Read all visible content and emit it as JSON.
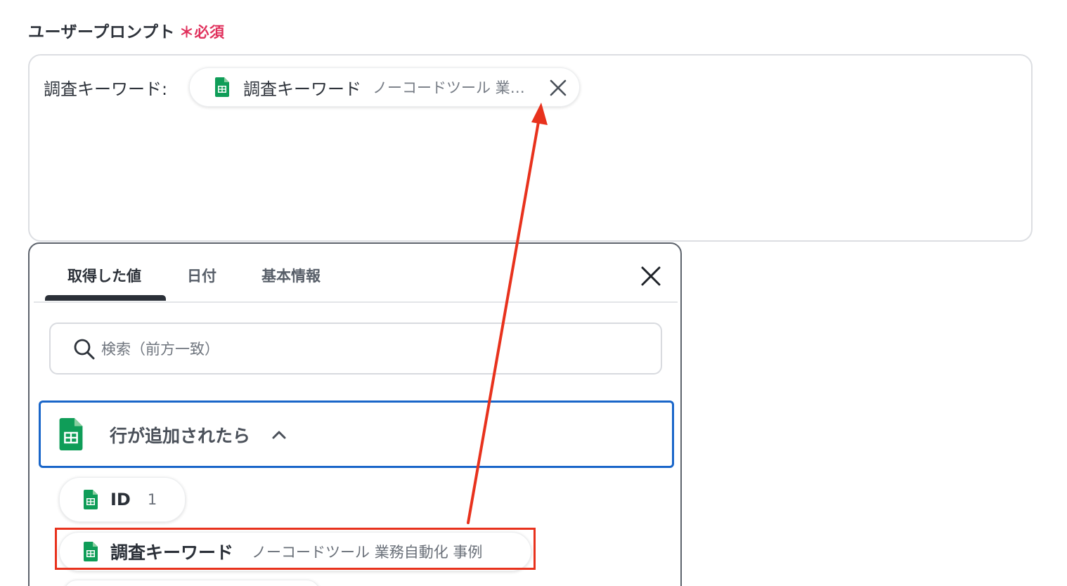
{
  "field": {
    "label": "ユーザープロンプト",
    "required_mark": "＊必須"
  },
  "prompt": {
    "prefix": "調査キーワード:",
    "chip": {
      "icon": "google-sheets-icon",
      "title": "調査キーワード",
      "value": "ノーコードツール 業務自動化 事例"
    }
  },
  "picker": {
    "tabs": [
      {
        "label": "取得した値",
        "active": true
      },
      {
        "label": "日付",
        "active": false
      },
      {
        "label": "基本情報",
        "active": false
      }
    ],
    "search": {
      "placeholder": "検索（前方一致）",
      "value": ""
    },
    "group": {
      "icon": "google-sheets-icon",
      "label": "行が追加されたら",
      "expanded": true
    },
    "items": [
      {
        "title": "ID",
        "value": "1"
      },
      {
        "title": "調査キーワード",
        "value": "ノーコードツール 業務自動化 事例"
      }
    ]
  },
  "colors": {
    "required": "#e0305c",
    "sheets_green": "#0f9d58",
    "group_border": "#1a66c9",
    "annotation_red": "#e8321d"
  }
}
